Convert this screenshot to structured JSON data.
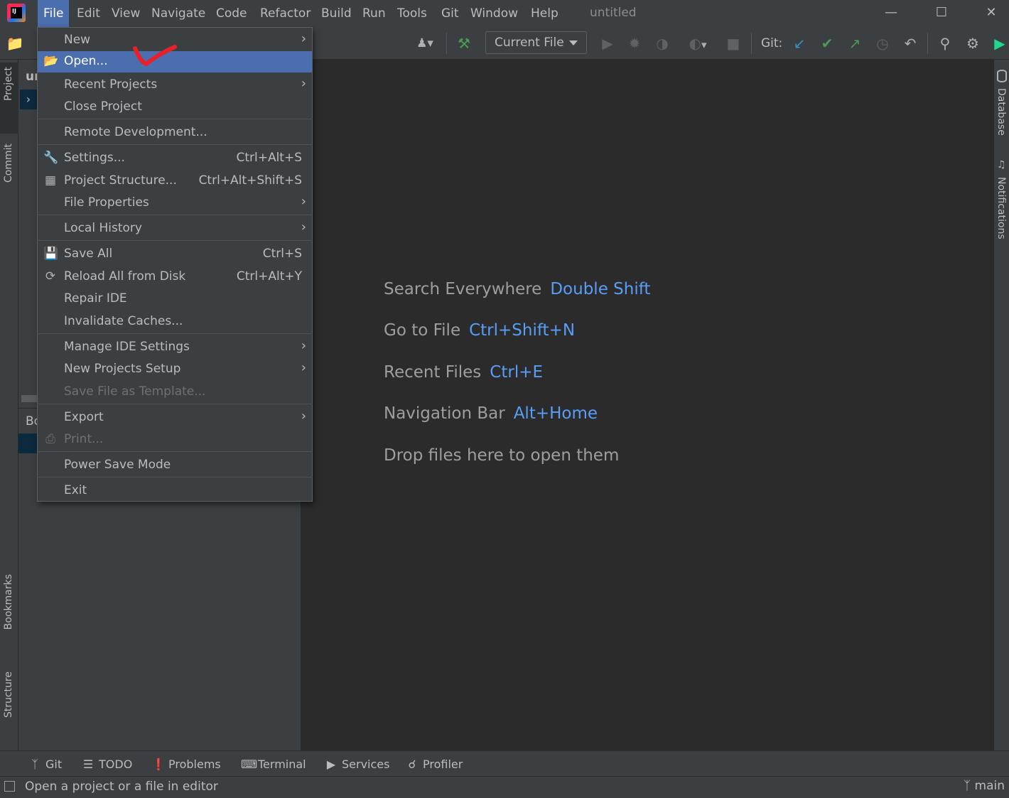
{
  "window": {
    "title": "untitled"
  },
  "menubar": {
    "items": [
      {
        "label": "File",
        "mnemonic": "F"
      },
      {
        "label": "Edit",
        "mnemonic": "E"
      },
      {
        "label": "View",
        "mnemonic": "V"
      },
      {
        "label": "Navigate",
        "mnemonic": "N"
      },
      {
        "label": "Code",
        "mnemonic": "C"
      },
      {
        "label": "Refactor",
        "mnemonic": "R"
      },
      {
        "label": "Build",
        "mnemonic": "B"
      },
      {
        "label": "Run",
        "mnemonic": "u"
      },
      {
        "label": "Tools",
        "mnemonic": "T"
      },
      {
        "label": "Git",
        "mnemonic": "G"
      },
      {
        "label": "Window",
        "mnemonic": "W"
      },
      {
        "label": "Help",
        "mnemonic": "H"
      }
    ]
  },
  "toolbar": {
    "run_config": "Current File",
    "git_label": "Git:"
  },
  "file_menu": {
    "new": "New",
    "open": "Open...",
    "recent_projects": "Recent Projects",
    "close_project": "Close Project",
    "remote_development": "Remote Development...",
    "settings": "Settings...",
    "settings_shortcut": "Ctrl+Alt+S",
    "project_structure": "Project Structure...",
    "project_structure_shortcut": "Ctrl+Alt+Shift+S",
    "file_properties": "File Properties",
    "local_history": "Local History",
    "save_all": "Save All",
    "save_all_shortcut": "Ctrl+S",
    "reload_all": "Reload All from Disk",
    "reload_all_shortcut": "Ctrl+Alt+Y",
    "repair_ide": "Repair IDE",
    "invalidate_caches": "Invalidate Caches...",
    "manage_ide_settings": "Manage IDE Settings",
    "new_projects_setup": "New Projects Setup",
    "save_file_as_template": "Save File as Template...",
    "export": "Export",
    "print": "Print...",
    "power_save_mode": "Power Save Mode",
    "exit": "Exit"
  },
  "project_panel": {
    "head_fragment": "ur",
    "bottom_fragment": "Bo"
  },
  "editor_hints": [
    {
      "label": "Search Everywhere",
      "key": "Double Shift"
    },
    {
      "label": "Go to File",
      "key": "Ctrl+Shift+N"
    },
    {
      "label": "Recent Files",
      "key": "Ctrl+E"
    },
    {
      "label": "Navigation Bar",
      "key": "Alt+Home"
    },
    {
      "label": "Drop files here to open them",
      "key": ""
    }
  ],
  "left_stripe": {
    "project": "Project",
    "commit": "Commit",
    "bookmarks": "Bookmarks",
    "structure": "Structure"
  },
  "right_stripe": {
    "database": "Database",
    "notifications": "Notifications"
  },
  "bottom_tabs": [
    "Git",
    "TODO",
    "Problems",
    "Terminal",
    "Services",
    "Profiler"
  ],
  "status": {
    "message": "Open a project or a file in editor",
    "branch": "main"
  },
  "colors": {
    "accent": "#4b6eaf",
    "key_hint": "#589df6",
    "annotation": "#e8202a"
  }
}
